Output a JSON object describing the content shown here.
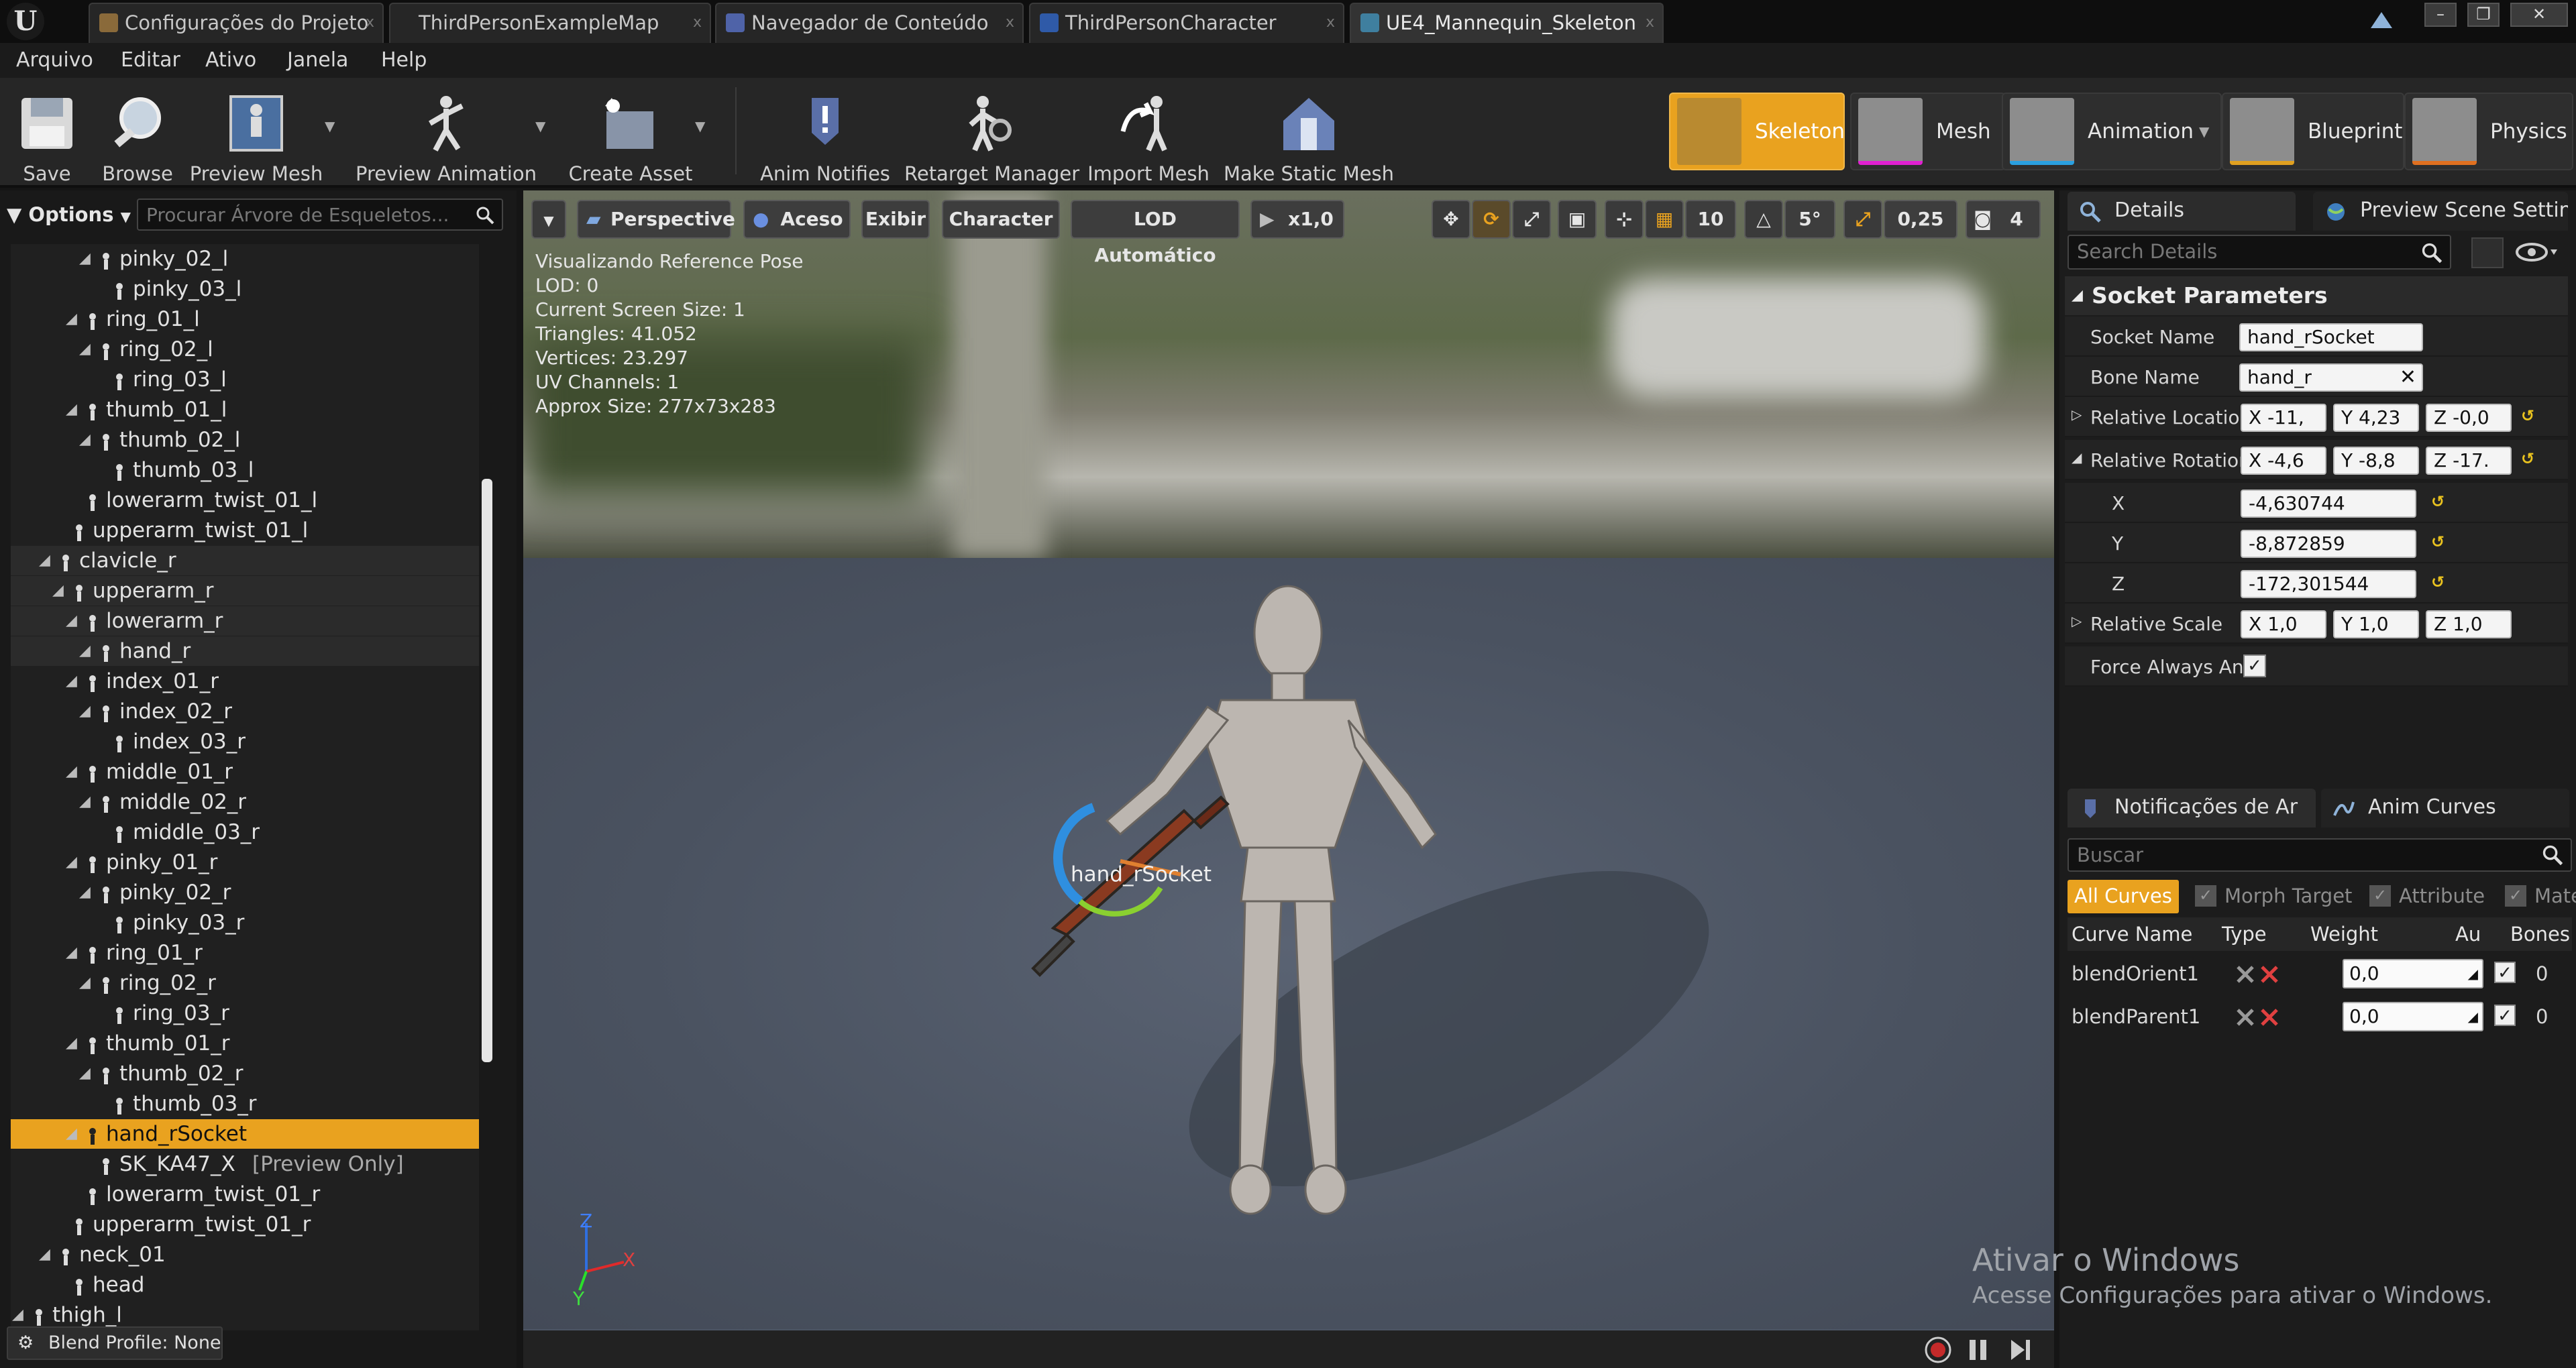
{
  "tabs": [
    {
      "label": "Configurações do Projeto",
      "close": "x"
    },
    {
      "label": "ThirdPersonExampleMap",
      "close": "x"
    },
    {
      "label": "Navegador de Conteúdo",
      "close": "x"
    },
    {
      "label": "ThirdPersonCharacter",
      "close": "x"
    },
    {
      "label": "UE4_Mannequin_Skeleton",
      "close": "x"
    }
  ],
  "window_buttons": {
    "minimize": "–",
    "maximize": "❐",
    "close": "✕"
  },
  "menu": [
    "Arquivo",
    "Editar",
    "Ativo",
    "Janela",
    "Help"
  ],
  "toolbar": {
    "save": "Save",
    "browse": "Browse",
    "preview_mesh": "Preview Mesh",
    "preview_animation": "Preview Animation",
    "create_asset": "Create Asset",
    "anim_notifies": "Anim Notifies",
    "retarget_manager": "Retarget Manager",
    "import_mesh": "Import Mesh",
    "make_static_mesh": "Make Static Mesh"
  },
  "modes": [
    "Skeleton",
    "Mesh",
    "Animation",
    "Blueprint",
    "Physics"
  ],
  "active_mode": "Skeleton",
  "colors": {
    "accent": "#e9a21f",
    "mesh_accent": "#e020d0"
  },
  "skeleton_tree": {
    "options_label": "Options",
    "search_placeholder": "Procurar Árvore de Esqueletos...",
    "nodes": [
      {
        "label": "pinky_02_l"
      },
      {
        "label": "pinky_03_l"
      },
      {
        "label": "ring_01_l"
      },
      {
        "label": "ring_02_l"
      },
      {
        "label": "ring_03_l"
      },
      {
        "label": "thumb_01_l"
      },
      {
        "label": "thumb_02_l"
      },
      {
        "label": "thumb_03_l"
      },
      {
        "label": "lowerarm_twist_01_l"
      },
      {
        "label": "upperarm_twist_01_l"
      },
      {
        "label": "clavicle_r"
      },
      {
        "label": "upperarm_r"
      },
      {
        "label": "lowerarm_r"
      },
      {
        "label": "hand_r"
      },
      {
        "label": "index_01_r"
      },
      {
        "label": "index_02_r"
      },
      {
        "label": "index_03_r"
      },
      {
        "label": "middle_01_r"
      },
      {
        "label": "middle_02_r"
      },
      {
        "label": "middle_03_r"
      },
      {
        "label": "pinky_01_r"
      },
      {
        "label": "pinky_02_r"
      },
      {
        "label": "pinky_03_r"
      },
      {
        "label": "ring_01_r"
      },
      {
        "label": "ring_02_r"
      },
      {
        "label": "ring_03_r"
      },
      {
        "label": "thumb_01_r"
      },
      {
        "label": "thumb_02_r"
      },
      {
        "label": "thumb_03_r"
      },
      {
        "label": "hand_rSocket"
      },
      {
        "label": "SK_KA47_X",
        "suffix": "[Preview Only]"
      },
      {
        "label": "lowerarm_twist_01_r"
      },
      {
        "label": "upperarm_twist_01_r"
      },
      {
        "label": "neck_01"
      },
      {
        "label": "head"
      },
      {
        "label": "thigh_l"
      }
    ],
    "blend_profile": "Blend Profile: None"
  },
  "viewport": {
    "perspective": "Perspective",
    "lit": "Aceso",
    "show": "Exibir",
    "character": "Character",
    "lod": "LOD Automático",
    "play_speed": "x1,0",
    "grid_snap": "10",
    "rot_snap": "5°",
    "scale_snap": "0,25",
    "cam_speed": "4",
    "info_lines": [
      "Visualizando Reference Pose",
      "LOD: 0",
      "Current Screen Size: 1",
      "Triangles: 41.052",
      "Vertices: 23.297",
      "UV Channels: 1",
      "Approx Size: 277x73x283"
    ],
    "socket_label": "hand_rSocket",
    "axis_z": "Z",
    "axis_y": "Y",
    "axis_x": "X"
  },
  "details": {
    "tab": "Details",
    "tab2": "Preview Scene Settings",
    "search_placeholder": "Search Details",
    "section": "Socket Parameters",
    "socket_name_label": "Socket Name",
    "socket_name": "hand_rSocket",
    "bone_name_label": "Bone Name",
    "bone_name": "hand_r",
    "relative_location_label": "Relative Location",
    "relative_location": {
      "x": "X -11,",
      "y": "Y 4,23",
      "z": "Z -0,0"
    },
    "relative_rotation_label": "Relative Rotation",
    "relative_rotation": {
      "x": "X -4,6",
      "y": "Y -8,8",
      "z": "Z -17."
    },
    "rotation_expanded": {
      "x_label": "X",
      "x_value": "-4,630744",
      "y_label": "Y",
      "y_value": "-8,872859",
      "z_label": "Z",
      "z_value": "-172,301544"
    },
    "relative_scale_label": "Relative Scale",
    "relative_scale": {
      "x": "X 1,0",
      "y": "Y 1,0",
      "z": "Z 1,0"
    },
    "force_always_label": "Force Always Ani",
    "force_always_checked": true
  },
  "curves": {
    "tab": "Notificações de Ar",
    "tab2": "Anim Curves",
    "search_placeholder": "Buscar",
    "filters": [
      "All Curves",
      "Morph Target",
      "Attribute",
      "Mate"
    ],
    "columns": [
      "Curve Name",
      "Type",
      "Weight",
      "Au",
      "Bones"
    ],
    "rows": [
      {
        "name": "blendOrient1",
        "weight": "0,0",
        "bones": "0"
      },
      {
        "name": "blendParent1",
        "weight": "0,0",
        "bones": "0"
      }
    ]
  },
  "watermark": {
    "title": "Ativar o Windows",
    "subtitle": "Acesse Configurações para ativar o Windows."
  }
}
